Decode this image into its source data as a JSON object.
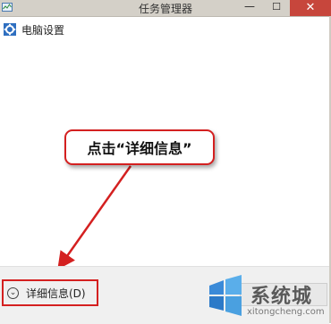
{
  "window": {
    "title": "任务管理器",
    "minimize_glyph": "—",
    "maximize_glyph": "☐",
    "close_glyph": "✕",
    "close_color": "#c7463c"
  },
  "apps": [
    {
      "label": "电脑设置",
      "icon": "gear-icon"
    }
  ],
  "annotation": {
    "text": "点击“详细信息”",
    "border_color": "#d42020"
  },
  "footer": {
    "details_label": "详细信息(D)",
    "details_icon": "chevron-down-icon"
  },
  "watermark": {
    "brand": "系统城",
    "url": "xitongcheng.com"
  }
}
